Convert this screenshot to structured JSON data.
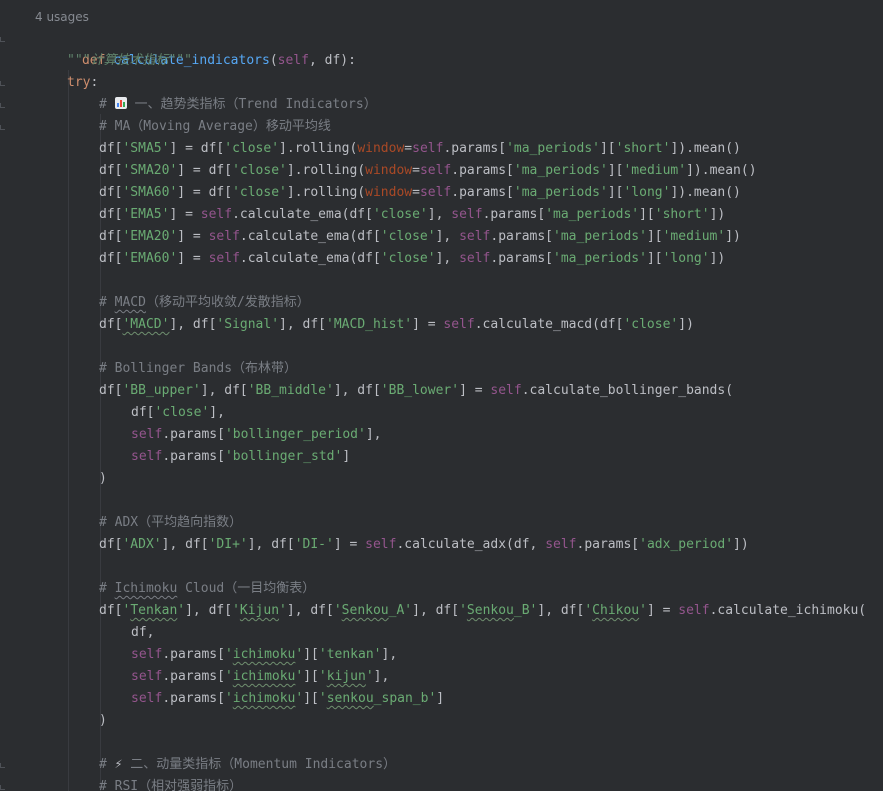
{
  "header": {
    "usages": "4 usages"
  },
  "lines": {
    "l01": {
      "kw": "def",
      "fn": "calculate_indicators",
      "p1": "(",
      "self": "self",
      "p2": ", df):"
    },
    "l02": {
      "doc": "\"\"\"计算技术指标\"\"\""
    },
    "l03": {
      "kw": "try",
      "p": ":"
    },
    "l04": {
      "pre": "# ",
      "icon": "bar-chart-emoji-icon",
      "post": " 一、趋势类指标（Trend Indicators）"
    },
    "l05": {
      "text": "# MA（Moving Average）移动平均线"
    },
    "l06": {
      "a": "df[",
      "s1": "'SMA5'",
      "b": "] = df[",
      "s2": "'close'",
      "c": "].rolling(",
      "w": "window",
      "d": "=",
      "self": "self",
      "e": ".params[",
      "s3": "'ma_periods'",
      "f": "][",
      "s4": "'short'",
      "g": "]).mean()"
    },
    "l07": {
      "a": "df[",
      "s1": "'SMA20'",
      "b": "] = df[",
      "s2": "'close'",
      "c": "].rolling(",
      "w": "window",
      "d": "=",
      "self": "self",
      "e": ".params[",
      "s3": "'ma_periods'",
      "f": "][",
      "s4": "'medium'",
      "g": "]).mean()"
    },
    "l08": {
      "a": "df[",
      "s1": "'SMA60'",
      "b": "] = df[",
      "s2": "'close'",
      "c": "].rolling(",
      "w": "window",
      "d": "=",
      "self": "self",
      "e": ".params[",
      "s3": "'ma_periods'",
      "f": "][",
      "s4": "'long'",
      "g": "]).mean()"
    },
    "l09": {
      "a": "df[",
      "s1": "'EMA5'",
      "b": "] = ",
      "self1": "self",
      "c": ".calculate_ema(df[",
      "s2": "'close'",
      "d": "], ",
      "self2": "self",
      "e": ".params[",
      "s3": "'ma_periods'",
      "f": "][",
      "s4": "'short'",
      "g": "])"
    },
    "l10": {
      "a": "df[",
      "s1": "'EMA20'",
      "b": "] = ",
      "self1": "self",
      "c": ".calculate_ema(df[",
      "s2": "'close'",
      "d": "], ",
      "self2": "self",
      "e": ".params[",
      "s3": "'ma_periods'",
      "f": "][",
      "s4": "'medium'",
      "g": "])"
    },
    "l11": {
      "a": "df[",
      "s1": "'EMA60'",
      "b": "] = ",
      "self1": "self",
      "c": ".calculate_ema(df[",
      "s2": "'close'",
      "d": "], ",
      "self2": "self",
      "e": ".params[",
      "s3": "'ma_periods'",
      "f": "][",
      "s4": "'long'",
      "g": "])"
    },
    "l13": {
      "pre": "# ",
      "macd": "MACD",
      "post": "（移动平均收敛/发散指标）"
    },
    "l14": {
      "a": "df[",
      "s1": "'MACD'",
      "b": "], df[",
      "s2": "'Signal'",
      "c": "], df[",
      "s3": "'MACD_hist'",
      "d": "] = ",
      "self": "self",
      "e": ".calculate_macd(df[",
      "s4": "'close'",
      "f": "])"
    },
    "l16": {
      "text": "# Bollinger Bands（布林带）"
    },
    "l17": {
      "a": "df[",
      "s1": "'BB_upper'",
      "b": "], df[",
      "s2": "'BB_middle'",
      "c": "], df[",
      "s3": "'BB_lower'",
      "d": "] = ",
      "self": "self",
      "e": ".calculate_bollinger_bands("
    },
    "l18": {
      "a": "df[",
      "s1": "'close'",
      "b": "],"
    },
    "l19": {
      "self": "self",
      "a": ".params[",
      "s1": "'bollinger_period'",
      "b": "],"
    },
    "l20": {
      "self": "self",
      "a": ".params[",
      "s1": "'bollinger_std'",
      "b": "]"
    },
    "l21": {
      "text": ")"
    },
    "l23": {
      "text": "# ADX（平均趋向指数）"
    },
    "l24": {
      "a": "df[",
      "s1": "'ADX'",
      "b": "], df[",
      "s2": "'DI+'",
      "c": "], df[",
      "s3": "'DI-'",
      "d": "] = ",
      "self1": "self",
      "e": ".calculate_adx(df, ",
      "self2": "self",
      "f": ".params[",
      "s4": "'adx_period'",
      "g": "])"
    },
    "l26": {
      "pre": "# ",
      "ich": "Ichimoku",
      "post": " Cloud（一目均衡表）"
    },
    "l27": {
      "a": "df[",
      "s1a": "'",
      "s1b": "Tenkan",
      "s1c": "'",
      "b": "], df[",
      "s2a": "'",
      "s2b": "Kijun",
      "s2c": "'",
      "c": "], df[",
      "s3a": "'",
      "s3b": "Senkou",
      "s3c": "_A'",
      "d": "], df[",
      "s4a": "'",
      "s4b": "Senkou",
      "s4c": "_B'",
      "e": "], df[",
      "s5a": "'",
      "s5b": "Chikou",
      "s5c": "'",
      "f": "] = ",
      "self": "self",
      "g": ".calculate_ichimoku("
    },
    "l28": {
      "text": "df,"
    },
    "l29": {
      "self": "self",
      "a": ".params[",
      "s1a": "'",
      "s1b": "ichimoku",
      "s1c": "'",
      "b": "][",
      "s2": "'tenkan'",
      "c": "],"
    },
    "l30": {
      "self": "self",
      "a": ".params[",
      "s1a": "'",
      "s1b": "ichimoku",
      "s1c": "'",
      "b": "][",
      "s2a": "'",
      "s2b": "kijun",
      "s2c": "'",
      "c": "],"
    },
    "l31": {
      "self": "self",
      "a": ".params[",
      "s1a": "'",
      "s1b": "ichimoku",
      "s1c": "'",
      "b": "][",
      "s2a": "'",
      "s2b": "senkou",
      "s2c": "_span_b'",
      "c": "]"
    },
    "l32": {
      "text": ")"
    },
    "l34": {
      "pre": "# ",
      "icon": "lightning-bolt-icon",
      "bolt": "⚡",
      "post": " 二、动量类指标（Momentum Indicators）"
    },
    "l35": {
      "pre": "# ",
      "rsi": "RSI",
      "post": "（相对强弱指标）"
    }
  }
}
